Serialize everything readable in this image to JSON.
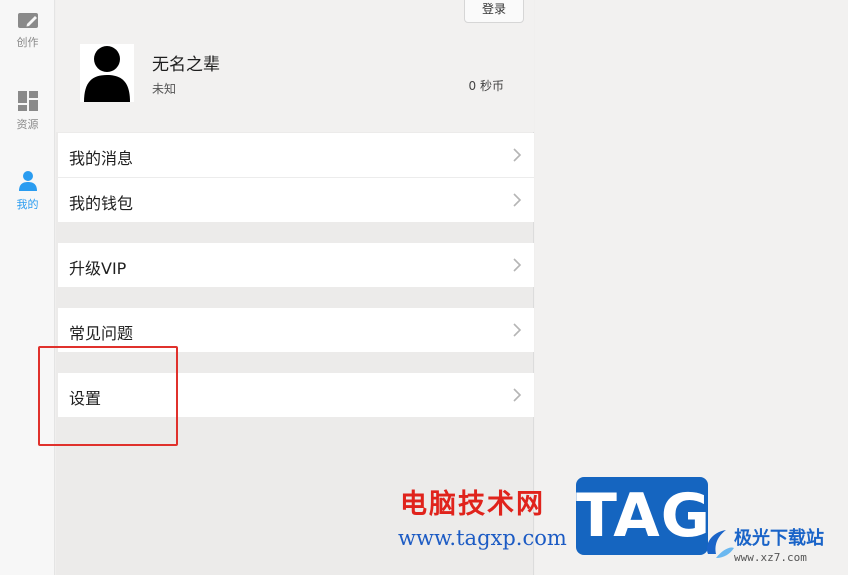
{
  "nav": {
    "items": [
      {
        "label": "创作",
        "icon": "edit-icon"
      },
      {
        "label": "资源",
        "icon": "grid-icon"
      },
      {
        "label": "我的",
        "icon": "user-icon",
        "active": true
      }
    ],
    "accent": "#2a9cf0"
  },
  "profile": {
    "login_label": "登录",
    "name": "无名之辈",
    "status": "未知",
    "coins": "0 秒币"
  },
  "menu": {
    "messages": "我的消息",
    "wallet": "我的钱包",
    "vip": "升级VIP",
    "faq": "常见问题",
    "settings": "设置"
  },
  "watermark": {
    "site_title": "电脑技术网",
    "site_url": "www.tagxp.com",
    "tag": "TAG",
    "brand": "极光下载站",
    "brand_url": "www.xz7.com",
    "title_color": "#e0231c",
    "url_color": "#1c5bc4"
  },
  "annotation_color": "#e0312c"
}
